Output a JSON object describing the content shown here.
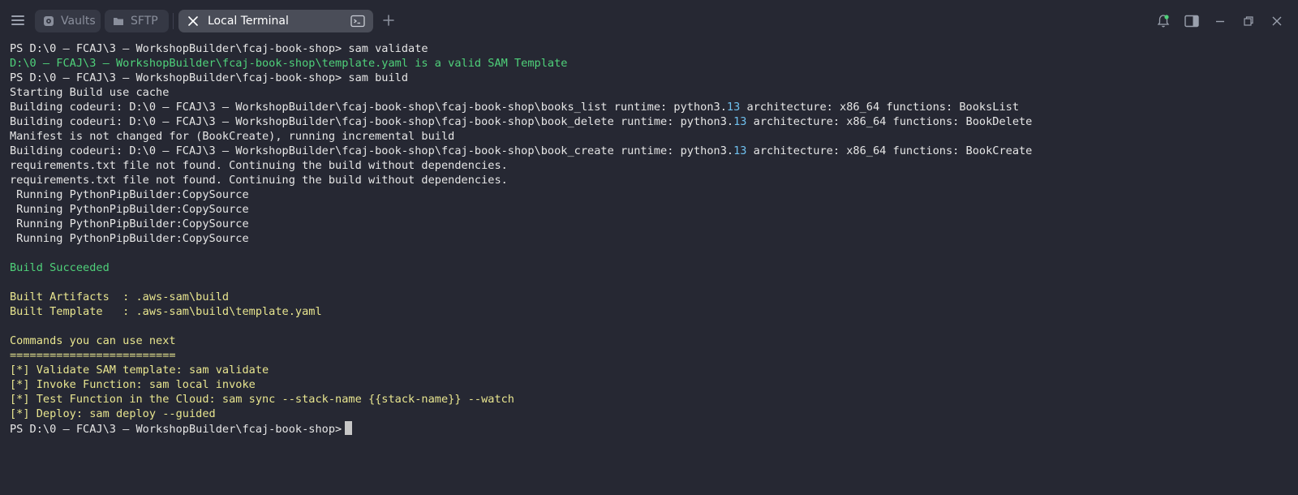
{
  "tabs": [
    {
      "label": "Vaults",
      "icon": "vault-icon"
    },
    {
      "label": "SFTP",
      "icon": "folder-icon"
    },
    {
      "label": "Local Terminal",
      "icon": "terminal-icon",
      "active": true
    }
  ],
  "toolbar": {
    "new_tab_icon": "plus-icon",
    "bell_icon": "notification-bell-icon",
    "sidebar_icon": "panel-toggle-icon",
    "minimize_icon": "minimize-icon",
    "restore_icon": "restore-icon",
    "close_icon": "close-icon"
  },
  "colors": {
    "background": "#262833",
    "success_green": "#4fd17a",
    "info_yellow": "#e8e58f",
    "version_cyan": "#6fc0ee",
    "bell_green": "#4fd17a"
  },
  "terminal": {
    "lines": [
      {
        "parts": [
          {
            "text": "PS D:\\0 – FCAJ\\3 – WorkshopBuilder\\fcaj-book-shop> sam validate",
            "c": ""
          }
        ]
      },
      {
        "parts": [
          {
            "text": "D:\\0 – FCAJ\\3 – WorkshopBuilder\\fcaj-book-shop\\template.yaml is a valid SAM Template",
            "c": "green"
          }
        ]
      },
      {
        "parts": [
          {
            "text": "PS D:\\0 – FCAJ\\3 – WorkshopBuilder\\fcaj-book-shop> sam build",
            "c": ""
          }
        ]
      },
      {
        "parts": [
          {
            "text": "Starting Build use cache",
            "c": ""
          }
        ]
      },
      {
        "parts": [
          {
            "text": "Building codeuri: D:\\0 – FCAJ\\3 – WorkshopBuilder\\fcaj-book-shop\\fcaj-book-shop\\books_list runtime: python3.",
            "c": ""
          },
          {
            "text": "13",
            "c": "cyan"
          },
          {
            "text": " architecture: x86_64 functions: BooksList",
            "c": ""
          }
        ]
      },
      {
        "parts": [
          {
            "text": "Building codeuri: D:\\0 – FCAJ\\3 – WorkshopBuilder\\fcaj-book-shop\\fcaj-book-shop\\book_delete runtime: python3.",
            "c": ""
          },
          {
            "text": "13",
            "c": "cyan"
          },
          {
            "text": " architecture: x86_64 functions: BookDelete",
            "c": ""
          }
        ]
      },
      {
        "parts": [
          {
            "text": "Manifest is not changed for (BookCreate), running incremental build",
            "c": ""
          }
        ]
      },
      {
        "parts": [
          {
            "text": "Building codeuri: D:\\0 – FCAJ\\3 – WorkshopBuilder\\fcaj-book-shop\\fcaj-book-shop\\book_create runtime: python3.",
            "c": ""
          },
          {
            "text": "13",
            "c": "cyan"
          },
          {
            "text": " architecture: x86_64 functions: BookCreate",
            "c": ""
          }
        ]
      },
      {
        "parts": [
          {
            "text": "requirements.txt file not found. Continuing the build without dependencies.",
            "c": ""
          }
        ]
      },
      {
        "parts": [
          {
            "text": "requirements.txt file not found. Continuing the build without dependencies.",
            "c": ""
          }
        ]
      },
      {
        "parts": [
          {
            "text": " Running PythonPipBuilder:CopySource",
            "c": ""
          }
        ]
      },
      {
        "parts": [
          {
            "text": " Running PythonPipBuilder:CopySource",
            "c": ""
          }
        ]
      },
      {
        "parts": [
          {
            "text": " Running PythonPipBuilder:CopySource",
            "c": ""
          }
        ]
      },
      {
        "parts": [
          {
            "text": " Running PythonPipBuilder:CopySource",
            "c": ""
          }
        ]
      },
      {
        "parts": [
          {
            "text": "",
            "c": ""
          }
        ]
      },
      {
        "parts": [
          {
            "text": "Build Succeeded",
            "c": "green"
          }
        ]
      },
      {
        "parts": [
          {
            "text": "",
            "c": ""
          }
        ]
      },
      {
        "parts": [
          {
            "text": "Built Artifacts  : .aws-sam\\build",
            "c": "yellow"
          }
        ]
      },
      {
        "parts": [
          {
            "text": "Built Template   : .aws-sam\\build\\template.yaml",
            "c": "yellow"
          }
        ]
      },
      {
        "parts": [
          {
            "text": "",
            "c": ""
          }
        ]
      },
      {
        "parts": [
          {
            "text": "Commands you can use next",
            "c": "yellow"
          }
        ]
      },
      {
        "parts": [
          {
            "text": "=========================",
            "c": "yellow"
          }
        ]
      },
      {
        "parts": [
          {
            "text": "[*] Validate SAM template: sam validate",
            "c": "yellow"
          }
        ]
      },
      {
        "parts": [
          {
            "text": "[*] Invoke Function: sam local invoke",
            "c": "yellow"
          }
        ]
      },
      {
        "parts": [
          {
            "text": "[*] Test Function in the Cloud: sam sync --stack-name {{stack-name}} --watch",
            "c": "yellow"
          }
        ]
      },
      {
        "parts": [
          {
            "text": "[*] Deploy: sam deploy --guided",
            "c": "yellow"
          }
        ]
      }
    ],
    "prompt": "PS D:\\0 – FCAJ\\3 – WorkshopBuilder\\fcaj-book-shop>"
  }
}
